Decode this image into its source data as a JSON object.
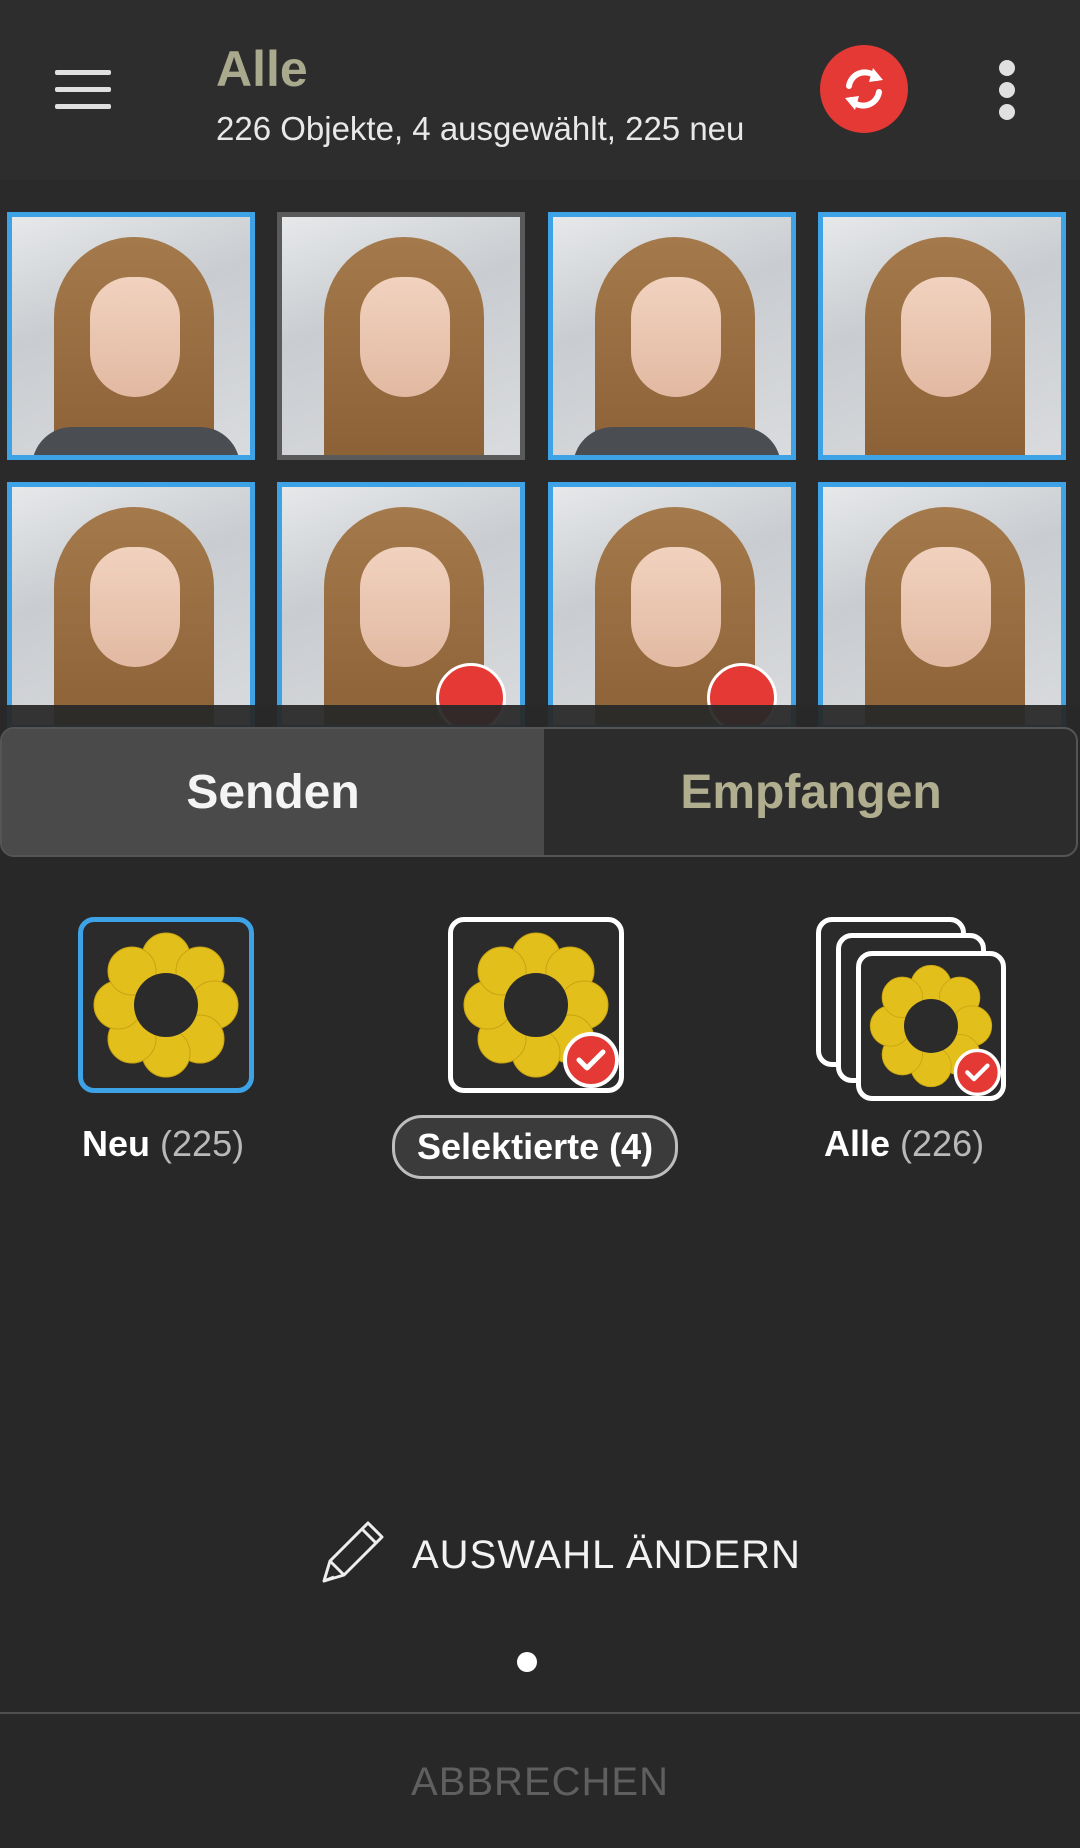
{
  "header": {
    "title": "Alle",
    "subtitle": "226 Objekte, 4 ausgewählt, 225 neu"
  },
  "grid": {
    "tiles": [
      {
        "selected": true,
        "checked": false
      },
      {
        "selected": false,
        "checked": false
      },
      {
        "selected": true,
        "checked": false
      },
      {
        "selected": true,
        "checked": false
      },
      {
        "selected": true,
        "checked": false
      },
      {
        "selected": true,
        "checked": true
      },
      {
        "selected": true,
        "checked": true
      },
      {
        "selected": true,
        "checked": false
      }
    ]
  },
  "sheet": {
    "tabs": [
      {
        "label": "Senden",
        "active": true
      },
      {
        "label": "Empfangen",
        "active": false
      }
    ],
    "options": [
      {
        "label": "Neu",
        "count": "(225)",
        "selected": true
      },
      {
        "label": "Selektierte (4)",
        "count": "",
        "selected": false
      },
      {
        "label": "Alle",
        "count": "(226)",
        "selected": false
      }
    ],
    "edit_label": "AUSWAHL ÄNDERN",
    "cancel_label": "ABBRECHEN"
  },
  "colors": {
    "accent_blue": "#3ea3e6",
    "accent_red": "#e53935",
    "title_olive": "#a9a98e",
    "flower_yellow": "#e3bf1c"
  },
  "icons": [
    "menu-icon",
    "sync-icon",
    "more-vert-icon",
    "flower-icon",
    "check-icon",
    "pencil-icon"
  ]
}
